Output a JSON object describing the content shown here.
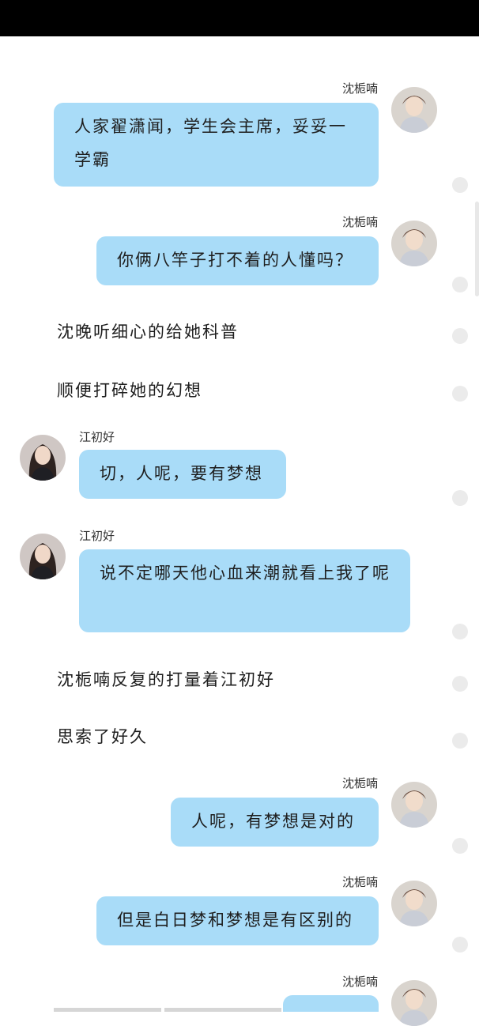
{
  "messages": [
    {
      "name": "沈栀喃",
      "text": "人家翟潇闻，学生会主席，妥妥一学霸"
    },
    {
      "name": "沈栀喃",
      "text": "你俩八竿子打不着的人懂吗？"
    },
    {
      "narration": "沈晚听细心的给她科普"
    },
    {
      "narration": "顺便打碎她的幻想"
    },
    {
      "name": "江初好",
      "text": "切，人呢，要有梦想"
    },
    {
      "name": "江初好",
      "text": "说不定哪天他心血来潮就看上我了呢"
    },
    {
      "narration": "沈栀喃反复的打量着江初好"
    },
    {
      "narration": "思索了好久"
    },
    {
      "name": "沈栀喃",
      "text": "人呢，有梦想是对的"
    },
    {
      "name": "沈栀喃",
      "text": "但是白日梦和梦想是有区别的"
    },
    {
      "name": "沈栀喃",
      "text": ""
    }
  ],
  "colors": {
    "bubble": "#a9dcf8",
    "background": "#ffffff",
    "status_bar": "#000000"
  }
}
